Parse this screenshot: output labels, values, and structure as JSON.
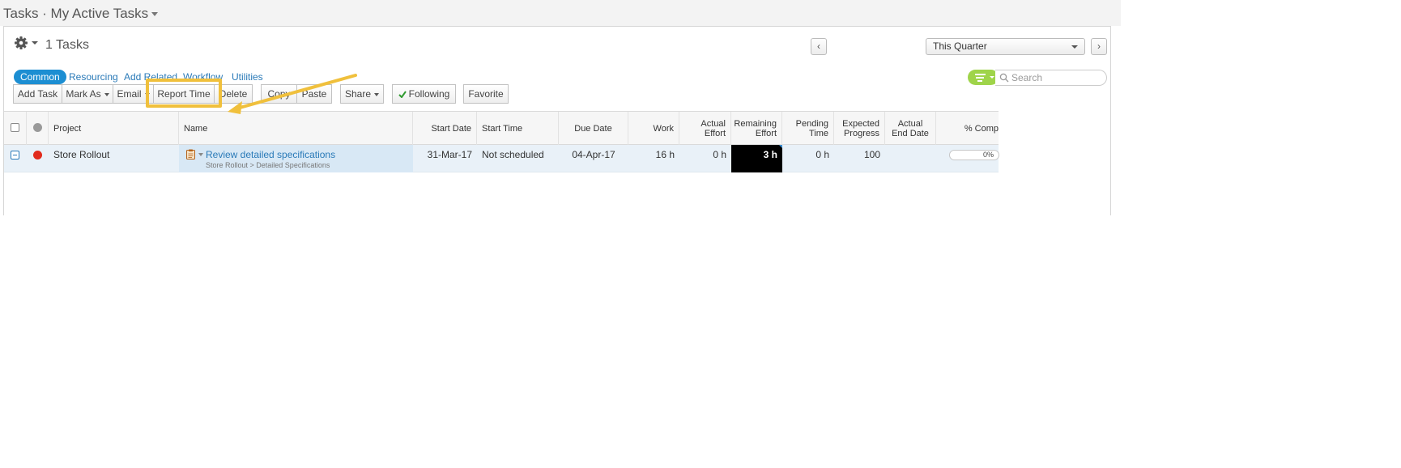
{
  "header": {
    "title": "Tasks · My Active Tasks"
  },
  "panel": {
    "task_count": "1 Tasks",
    "period_select": "This Quarter",
    "prev_label": "‹",
    "next_label": "›"
  },
  "tabs": [
    {
      "label": "Common",
      "active": true
    },
    {
      "label": "Resourcing",
      "active": false
    },
    {
      "label": "Add Related",
      "active": false
    },
    {
      "label": "Workflow",
      "active": false
    },
    {
      "label": "Utilities",
      "active": false
    }
  ],
  "search": {
    "placeholder": "Search"
  },
  "toolbar": {
    "add_task": "Add Task",
    "mark_as": "Mark As",
    "email": "Email",
    "report_time": "Report Time",
    "delete": "Delete",
    "copy": "Copy",
    "paste": "Paste",
    "share": "Share",
    "following": "Following",
    "favorite": "Favorite"
  },
  "grid": {
    "columns": {
      "project": "Project",
      "name": "Name",
      "start_date": "Start Date",
      "start_time": "Start Time",
      "due_date": "Due Date",
      "work": "Work",
      "actual_effort": "Actual Effort",
      "remaining_effort": "Remaining Effort",
      "pending_time": "Pending Time",
      "expected_progress": "Expected Progress",
      "actual_end_date": "Actual End Date",
      "pct_complete": "% Comp"
    },
    "rows": [
      {
        "project": "Store Rollout",
        "name": "Review detailed specifications",
        "path": "Store Rollout > Detailed Specifications",
        "start_date": "31-Mar-17",
        "start_time": "Not scheduled",
        "due_date": "04-Apr-17",
        "work": "16 h",
        "actual_effort": "0 h",
        "remaining_effort": "3 h",
        "pending_time": "0 h",
        "expected_progress": "100",
        "actual_end_date": "",
        "pct_complete": "0%",
        "pct_complete_value": 0
      }
    ]
  },
  "colors": {
    "accent": "#1c8ed2",
    "link": "#2a7ab8",
    "highlight": "#f0c03c",
    "filter": "#9fd44a",
    "status_red": "#e12b1d"
  }
}
